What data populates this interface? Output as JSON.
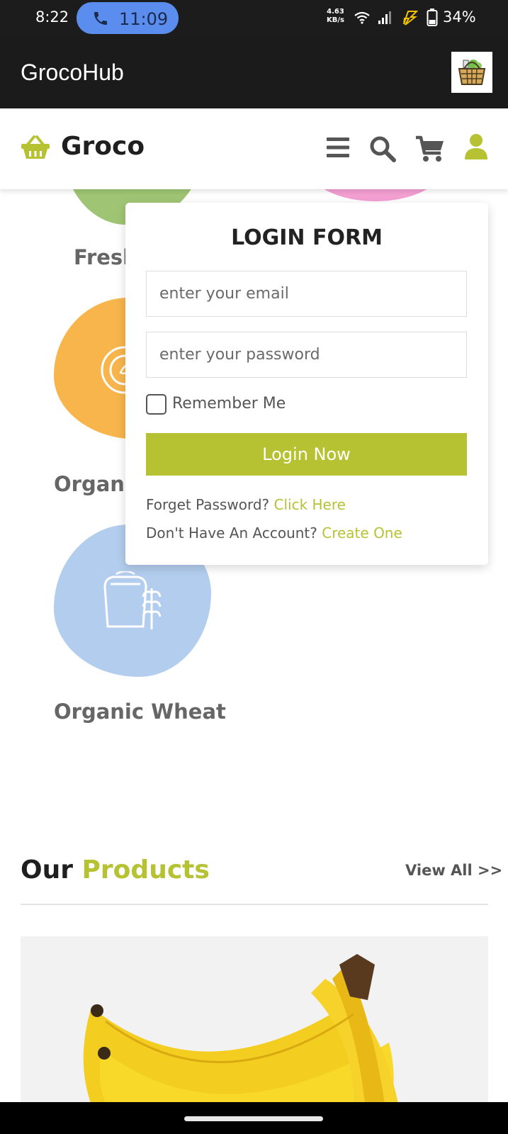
{
  "status_bar": {
    "time": "8:22",
    "call_time": "11:09",
    "net_speed_value": "4.63",
    "net_speed_unit": "KB/s",
    "battery": "34%"
  },
  "app_bar": {
    "title": "GrocoHub",
    "logo_icon": "grocery-basket-logo"
  },
  "header": {
    "brand": "Groco",
    "icons": [
      "menu-icon",
      "search-icon",
      "cart-icon",
      "user-icon"
    ]
  },
  "categories": [
    {
      "label": "Fresh",
      "color": "#9fc574"
    },
    {
      "label": "",
      "color": "#f49fd3"
    },
    {
      "label": "Organi",
      "color": "#f8b54c"
    },
    {
      "label": "Organic Wheat",
      "color": "#b3cdee"
    }
  ],
  "login": {
    "title": "LOGIN FORM",
    "email_placeholder": "enter your email",
    "password_placeholder": "enter your password",
    "remember_label": "Remember Me",
    "remember_checked": false,
    "button_label": "Login Now",
    "forgot_text": "Forget Password?",
    "forgot_link": "Click Here",
    "no_account_text": "Don't Have An Account?",
    "create_link": "Create One"
  },
  "products": {
    "title_plain": "Our",
    "title_accent": "Products",
    "view_all": "View All >>"
  },
  "colors": {
    "accent": "#b6c232",
    "dark_bar": "#1b1b1b",
    "call_pill": "#5b8def"
  }
}
